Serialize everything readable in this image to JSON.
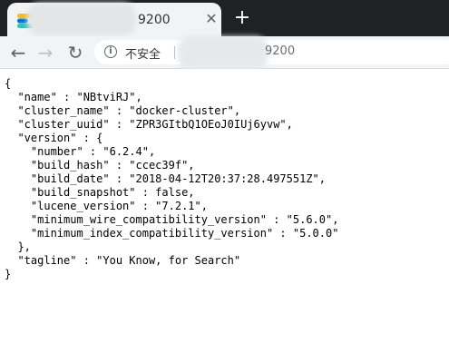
{
  "tab": {
    "title": "9200",
    "close_glyph": "✕",
    "favicon_icon": "elastic-favicon-icon"
  },
  "new_tab_glyph": "+",
  "toolbar": {
    "back_glyph": "←",
    "forward_glyph": "→",
    "reload_glyph": "↻",
    "security_label": "不安全",
    "url_tail": "9200"
  },
  "page": {
    "json_text": "{\n  \"name\" : \"NBtviRJ\",\n  \"cluster_name\" : \"docker-cluster\",\n  \"cluster_uuid\" : \"ZPR3GItbQ1OEoJ0IUj6yvw\",\n  \"version\" : {\n    \"number\" : \"6.2.4\",\n    \"build_hash\" : \"ccec39f\",\n    \"build_date\" : \"2018-04-12T20:37:28.497551Z\",\n    \"build_snapshot\" : false,\n    \"lucene_version\" : \"7.2.1\",\n    \"minimum_wire_compatibility_version\" : \"5.6.0\",\n    \"minimum_index_compatibility_version\" : \"5.0.0\"\n  },\n  \"tagline\" : \"You Know, for Search\"\n}"
  },
  "colors": {
    "tabstrip_bg": "#202124",
    "toolbar_bg": "#f1f3f4"
  }
}
